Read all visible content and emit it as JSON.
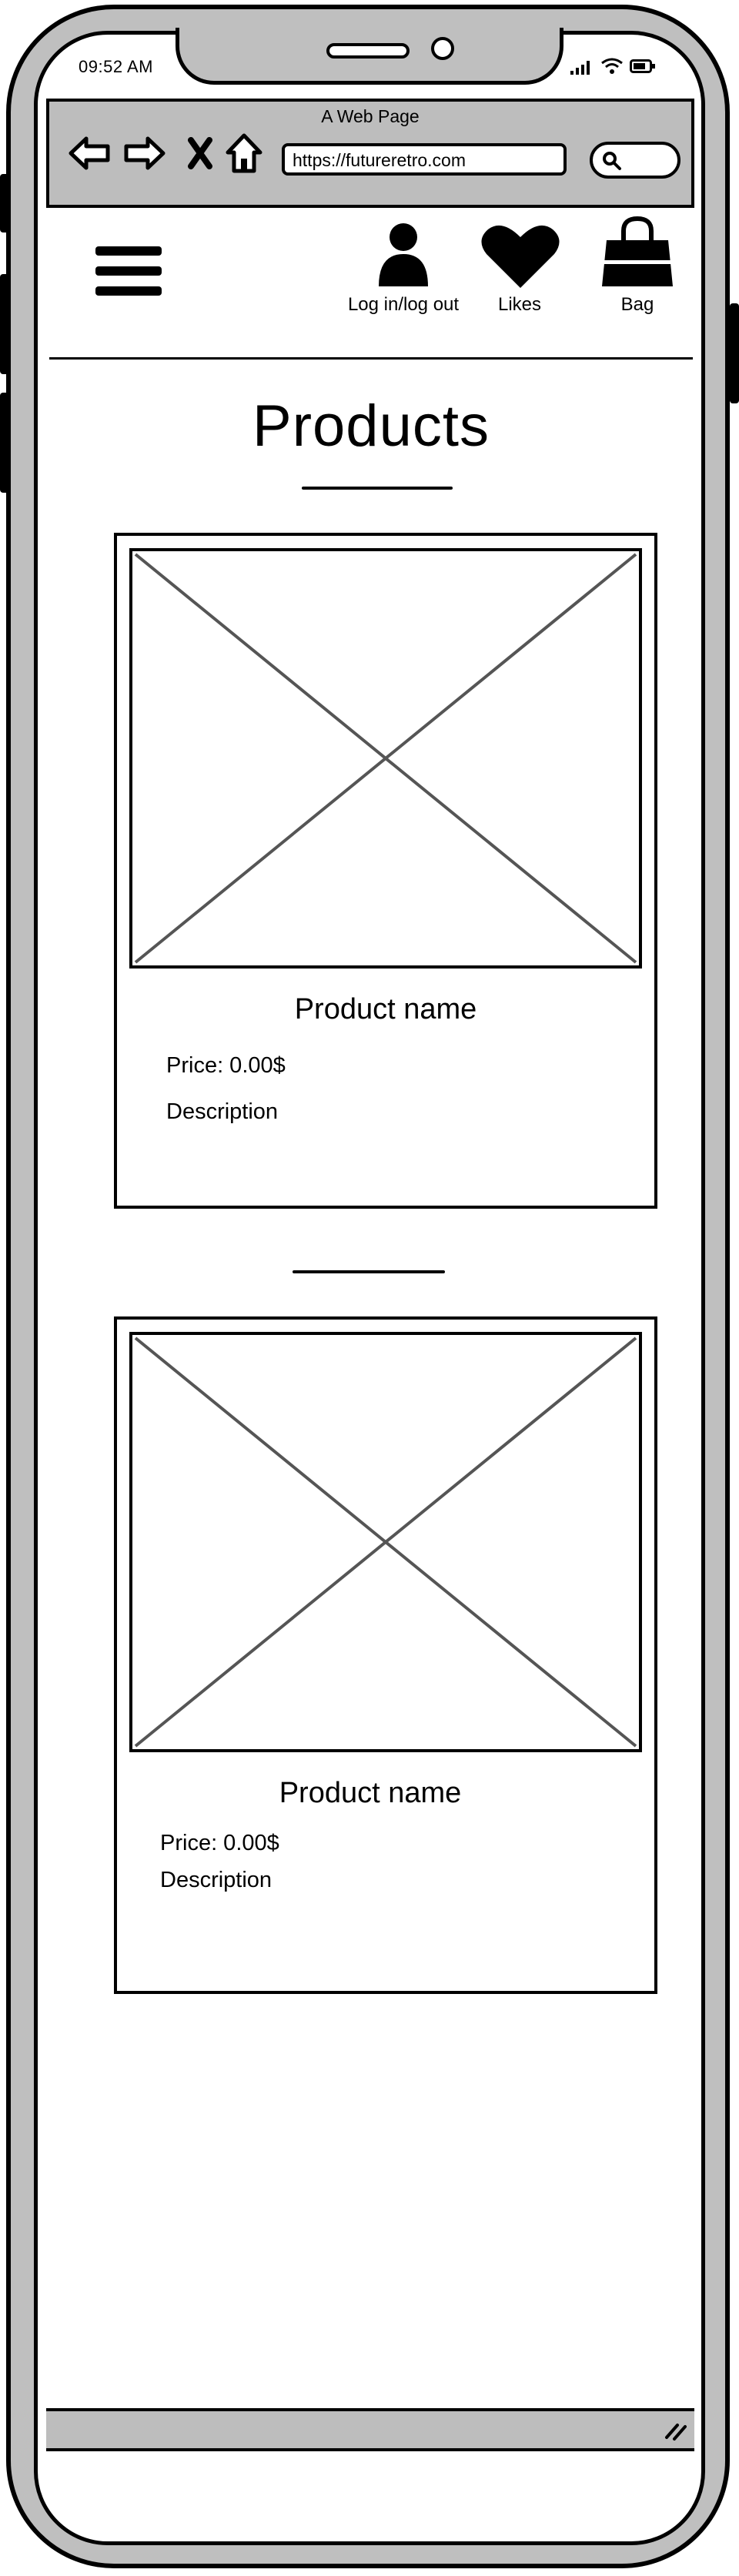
{
  "status_bar": {
    "time": "09:52 AM"
  },
  "browser": {
    "page_title": "A Web Page",
    "url": "https://futureretro.com",
    "icons": [
      "back-arrow-icon",
      "forward-arrow-icon",
      "close-icon",
      "home-icon",
      "search-icon"
    ]
  },
  "header": {
    "menu_icon": "hamburger-menu-icon",
    "login_label": "Log in/log out",
    "likes_label": "Likes",
    "bag_label": "Bag"
  },
  "main": {
    "title": "Products",
    "products": [
      {
        "name": "Product name",
        "price": "Price: 0.00$",
        "description": "Description"
      },
      {
        "name": "Product name",
        "price": "Price: 0.00$",
        "description": "Description"
      }
    ]
  },
  "colors": {
    "frame_gray": "#bfbfbf",
    "ink": "#000000",
    "placeholder_line": "#555555"
  }
}
